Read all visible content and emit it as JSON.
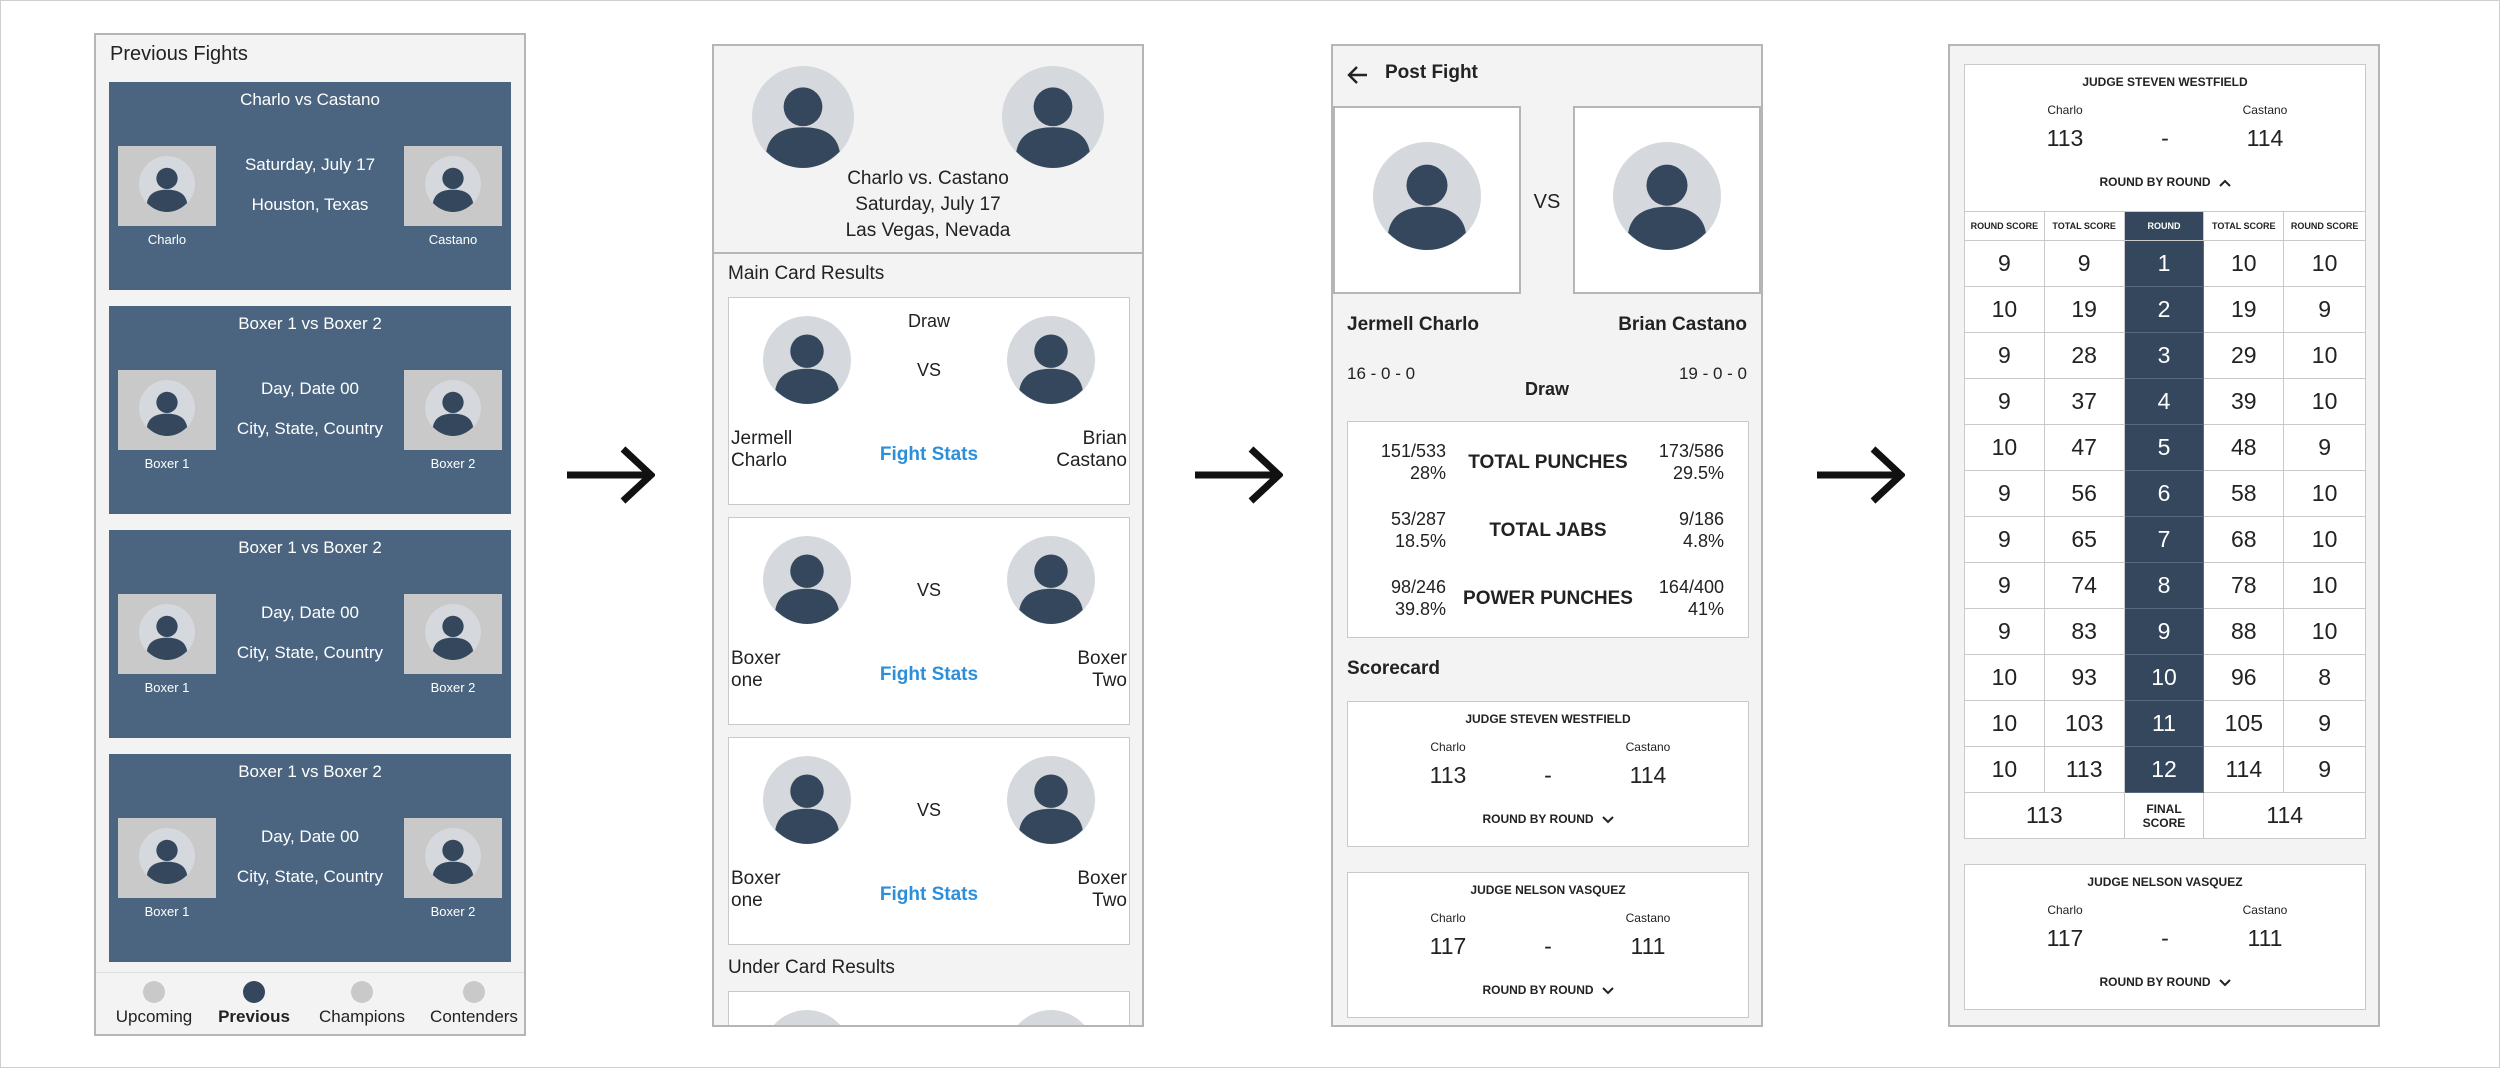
{
  "screen1": {
    "title": "Previous Fights",
    "fights": [
      {
        "title": "Charlo vs Castano",
        "date": "Saturday, July 17",
        "location": "Houston, Texas",
        "left": "Charlo",
        "right": "Castano"
      },
      {
        "title": "Boxer 1 vs Boxer 2",
        "date": "Day, Date 00",
        "location": "City, State, Country",
        "left": "Boxer 1",
        "right": "Boxer 2"
      },
      {
        "title": "Boxer 1 vs Boxer 2",
        "date": "Day, Date 00",
        "location": "City, State, Country",
        "left": "Boxer 1",
        "right": "Boxer 2"
      },
      {
        "title": "Boxer 1 vs Boxer 2",
        "date": "Day, Date 00",
        "location": "City, State, Country",
        "left": "Boxer 1",
        "right": "Boxer 2"
      }
    ],
    "nav": [
      "Upcoming",
      "Previous",
      "Champions",
      "Contenders"
    ]
  },
  "screen2": {
    "header_title": "Charlo vs. Castano",
    "header_date": "Saturday, July 17",
    "header_location": "Las Vegas, Nevada",
    "main_card_label": "Main Card Results",
    "under_card_label": "Under Card Results",
    "vs": "VS",
    "fight_stats": "Fight Stats",
    "results": [
      {
        "result": "Draw",
        "left": "Jermell\nCharlo",
        "right": "Brian\nCastano"
      },
      {
        "result": "",
        "left": "Boxer\none",
        "right": "Boxer\nTwo"
      },
      {
        "result": "",
        "left": "Boxer\none",
        "right": "Boxer\nTwo"
      }
    ]
  },
  "screen3": {
    "title": "Post Fight",
    "vs": "VS",
    "left_name": "Jermell Charlo",
    "right_name": "Brian Castano",
    "left_record": "16 - 0 - 0",
    "right_record": "19 - 0 - 0",
    "result": "Draw",
    "stats": [
      {
        "label": "TOTAL PUNCHES",
        "left": "151/533\n28%",
        "right": "173/586\n29.5%"
      },
      {
        "label": "TOTAL JABS",
        "left": "53/287\n18.5%",
        "right": "9/186\n4.8%"
      },
      {
        "label": "POWER PUNCHES",
        "left": "98/246\n39.8%",
        "right": "164/400\n41%"
      }
    ],
    "scorecard_label": "Scorecard",
    "judges": [
      {
        "name": "JUDGE STEVEN WESTFIELD",
        "left_name": "Charlo",
        "right_name": "Castano",
        "left_score": "113",
        "dash": "-",
        "right_score": "114",
        "toggle": "ROUND BY ROUND"
      },
      {
        "name": "JUDGE NELSON VASQUEZ",
        "left_name": "Charlo",
        "right_name": "Castano",
        "left_score": "117",
        "dash": "-",
        "right_score": "111",
        "toggle": "ROUND BY ROUND"
      }
    ]
  },
  "screen4": {
    "judge1": {
      "name": "JUDGE STEVEN WESTFIELD",
      "left_name": "Charlo",
      "right_name": "Castano",
      "left_score": "113",
      "dash": "-",
      "right_score": "114",
      "toggle": "ROUND BY ROUND"
    },
    "headers": [
      "ROUND SCORE",
      "TOTAL SCORE",
      "ROUND",
      "TOTAL SCORE",
      "ROUND SCORE"
    ],
    "rounds": [
      [
        "9",
        "9",
        "1",
        "10",
        "10"
      ],
      [
        "10",
        "19",
        "2",
        "19",
        "9"
      ],
      [
        "9",
        "28",
        "3",
        "29",
        "10"
      ],
      [
        "9",
        "37",
        "4",
        "39",
        "10"
      ],
      [
        "10",
        "47",
        "5",
        "48",
        "9"
      ],
      [
        "9",
        "56",
        "6",
        "58",
        "10"
      ],
      [
        "9",
        "65",
        "7",
        "68",
        "10"
      ],
      [
        "9",
        "74",
        "8",
        "78",
        "10"
      ],
      [
        "9",
        "83",
        "9",
        "88",
        "10"
      ],
      [
        "10",
        "93",
        "10",
        "96",
        "8"
      ],
      [
        "10",
        "103",
        "11",
        "105",
        "9"
      ],
      [
        "10",
        "113",
        "12",
        "114",
        "9"
      ]
    ],
    "final_left": "113",
    "final_label": "FINAL\nSCORE",
    "final_right": "114",
    "judge2": {
      "name": "JUDGE NELSON VASQUEZ",
      "left_name": "Charlo",
      "right_name": "Castano",
      "left_score": "117",
      "dash": "-",
      "right_score": "111",
      "toggle": "ROUND BY ROUND"
    }
  },
  "colors": {
    "card_blue": "#4b6580",
    "dark_navy": "#34475c",
    "link_blue": "#2d8fd9",
    "placeholder_gray": "#c9c9c9"
  }
}
